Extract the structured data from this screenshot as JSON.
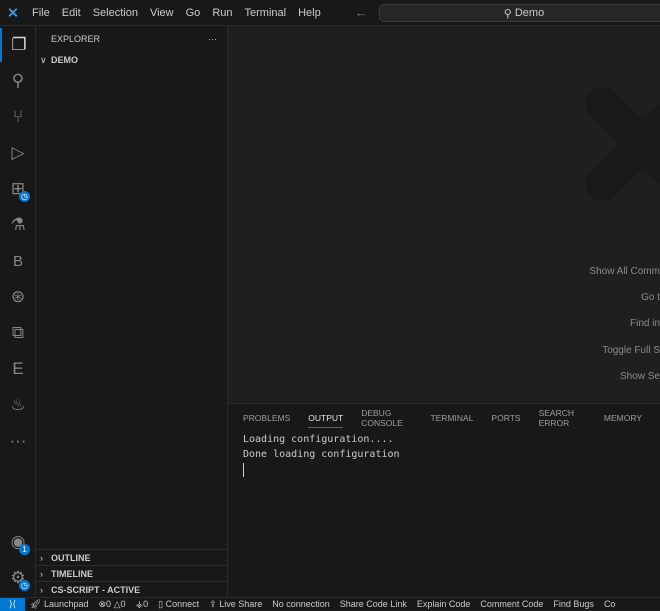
{
  "titlebar": {
    "menu": [
      "File",
      "Edit",
      "Selection",
      "View",
      "Go",
      "Run",
      "Terminal",
      "Help"
    ],
    "search": "Demo"
  },
  "activity": {
    "accounts_badge": "1"
  },
  "sidebar": {
    "title": "EXPLORER",
    "more": "···",
    "folder": "DEMO",
    "sections": [
      "OUTLINE",
      "TIMELINE",
      "CS-SCRIPT - ACTIVE"
    ]
  },
  "editor": {
    "hints": [
      "Show All Comm",
      "Go t",
      "Find in",
      "Toggle Full S",
      "Show Se"
    ]
  },
  "panel": {
    "tabs": [
      "PROBLEMS",
      "OUTPUT",
      "DEBUG CONSOLE",
      "TERMINAL",
      "PORTS",
      "SEARCH ERROR",
      "MEMORY"
    ],
    "active_tab": "OUTPUT",
    "lines": [
      "Loading configuration....",
      "Done loading configuration"
    ]
  },
  "status": {
    "launchpad": "Launchpad",
    "errors": "0",
    "warnings": "0",
    "ports": "0",
    "connect": "Connect",
    "liveshare": "Live Share",
    "items": [
      "No connection",
      "Share Code Link",
      "Explain Code",
      "Comment Code",
      "Find Bugs",
      "Co"
    ]
  },
  "colors": {
    "accent": "#0078d4"
  }
}
